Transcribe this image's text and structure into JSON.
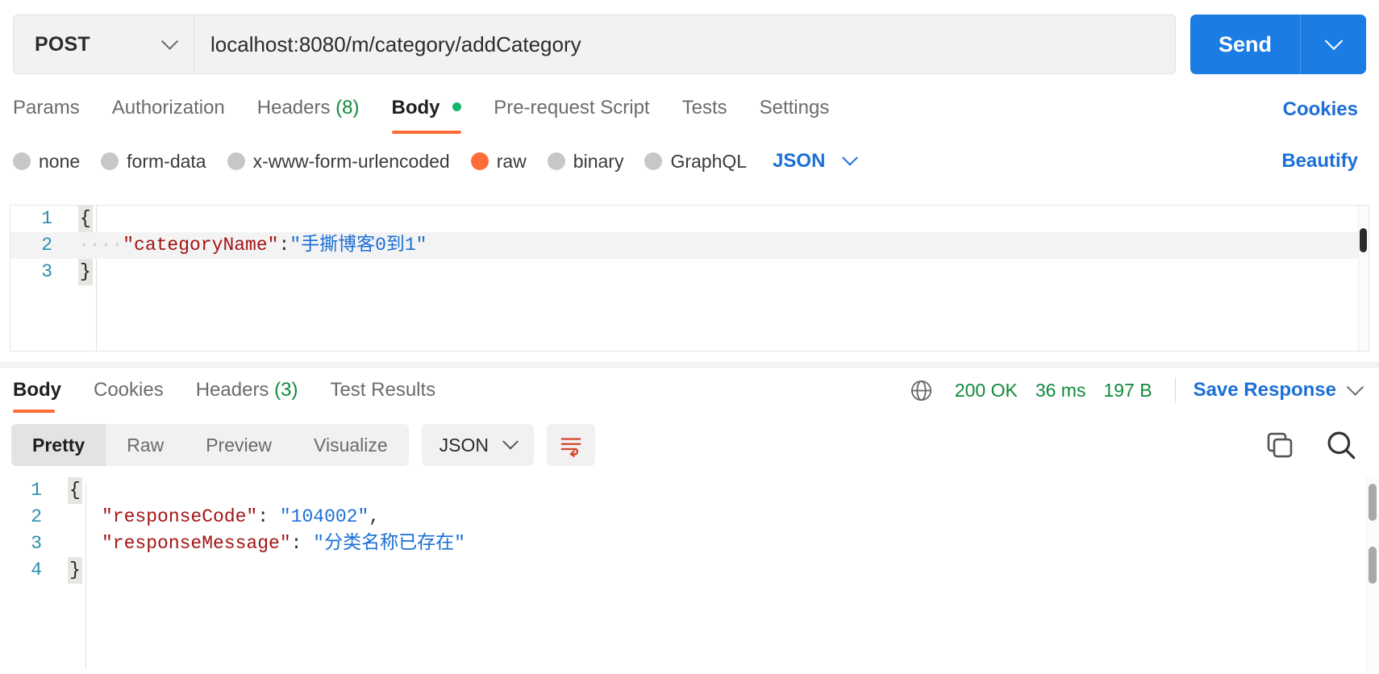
{
  "request": {
    "method": "POST",
    "method_chevron_icon": "chevron-down-icon",
    "url": "localhost:8080/m/category/addCategory",
    "send_label": "Send",
    "send_chevron_icon": "chevron-down-icon",
    "tabs": [
      {
        "label": "Params",
        "active": false
      },
      {
        "label": "Authorization",
        "active": false
      },
      {
        "label": "Headers",
        "count": "(8)",
        "active": false
      },
      {
        "label": "Body",
        "active": true,
        "dot": true
      },
      {
        "label": "Pre-request Script",
        "active": false
      },
      {
        "label": "Tests",
        "active": false
      },
      {
        "label": "Settings",
        "active": false
      }
    ],
    "cookies_label": "Cookies",
    "body_types": [
      {
        "label": "none",
        "selected": false
      },
      {
        "label": "form-data",
        "selected": false
      },
      {
        "label": "x-www-form-urlencoded",
        "selected": false
      },
      {
        "label": "raw",
        "selected": true
      },
      {
        "label": "binary",
        "selected": false
      },
      {
        "label": "GraphQL",
        "selected": false
      }
    ],
    "raw_format": "JSON",
    "raw_format_chevron_icon": "chevron-down-icon",
    "beautify_label": "Beautify",
    "body_lines": [
      {
        "num": "1",
        "indent_dots": "",
        "brace": "{",
        "key": "",
        "colon": "",
        "value": "",
        "trail": ""
      },
      {
        "num": "2",
        "indent_dots": "····",
        "brace": "",
        "key": "\"categoryName\"",
        "colon": ":",
        "value": "\"手撕博客0到1\"",
        "trail": ""
      },
      {
        "num": "3",
        "indent_dots": "",
        "brace": "}",
        "key": "",
        "colon": "",
        "value": "",
        "trail": ""
      }
    ]
  },
  "response": {
    "tabs": [
      {
        "label": "Body",
        "active": true
      },
      {
        "label": "Cookies",
        "active": false
      },
      {
        "label": "Headers",
        "count": "(3)",
        "active": false
      },
      {
        "label": "Test Results",
        "active": false
      }
    ],
    "globe_icon": "globe-icon",
    "status": "200 OK",
    "time": "36 ms",
    "size": "197 B",
    "save_response_label": "Save Response",
    "save_response_chevron_icon": "chevron-down-icon",
    "view_modes": [
      {
        "label": "Pretty",
        "active": true
      },
      {
        "label": "Raw",
        "active": false
      },
      {
        "label": "Preview",
        "active": false
      },
      {
        "label": "Visualize",
        "active": false
      }
    ],
    "format": "JSON",
    "format_chevron_icon": "chevron-down-icon",
    "wrap_icon": "wrap-lines-icon",
    "copy_icon": "copy-icon",
    "search_icon": "search-icon",
    "body_lines": [
      {
        "num": "1",
        "brace": "{",
        "key": "",
        "colon": "",
        "value": "",
        "trail": ""
      },
      {
        "num": "2",
        "brace": "",
        "key": "\"responseCode\"",
        "colon": ":",
        "value": "\"104002\"",
        "trail": ","
      },
      {
        "num": "3",
        "brace": "",
        "key": "\"responseMessage\"",
        "colon": ":",
        "value": "\"分类名称已存在\"",
        "trail": ""
      },
      {
        "num": "4",
        "brace": "}",
        "key": "",
        "colon": "",
        "value": "",
        "trail": ""
      }
    ]
  },
  "colors": {
    "accent_orange": "#ff6c37",
    "link_blue": "#1b6fd6",
    "send_blue": "#1b7ce3",
    "status_green": "#0f8a3c",
    "json_key_red": "#a31515",
    "json_string_blue": "#1b6fd6",
    "line_number_teal": "#2d8fae"
  }
}
